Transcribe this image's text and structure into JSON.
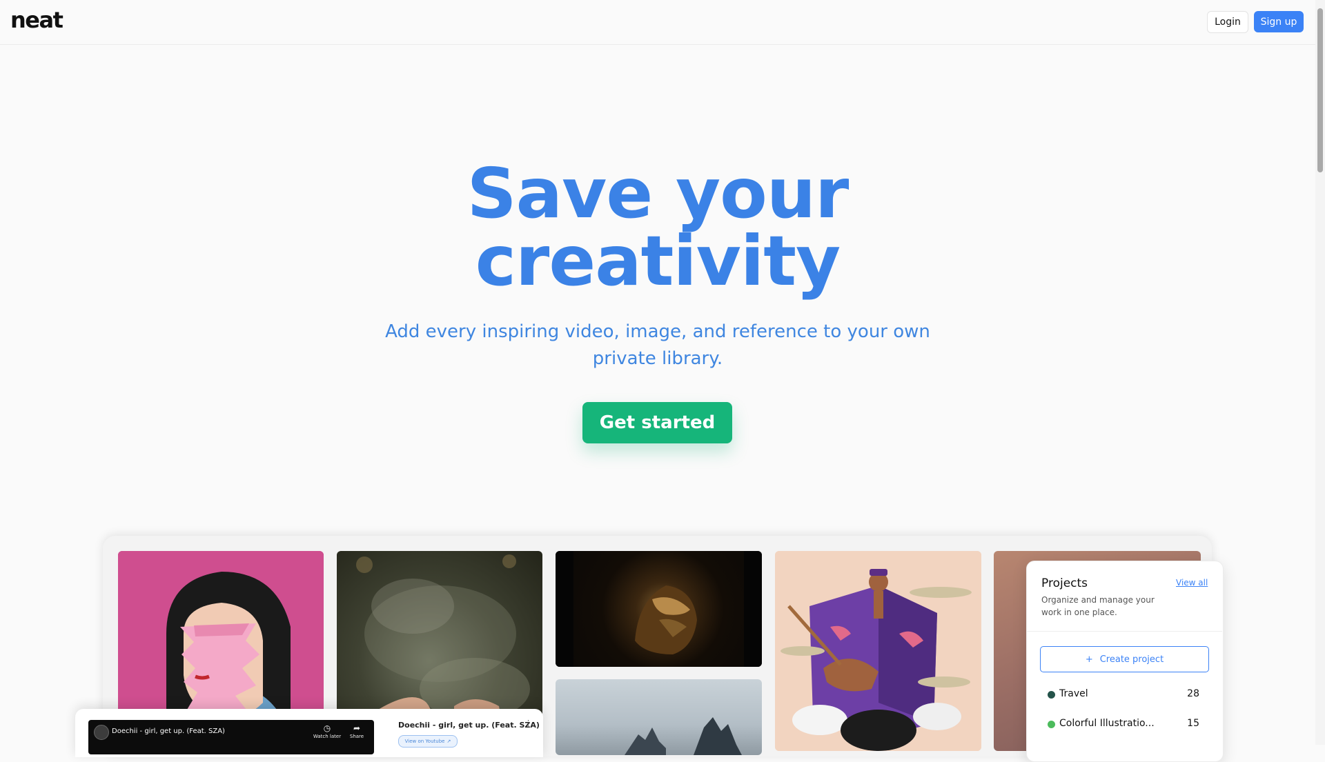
{
  "header": {
    "logo": "neat",
    "login_label": "Login",
    "signup_label": "Sign up"
  },
  "hero": {
    "title_line1": "Save your",
    "title_line2": "creativity",
    "subtitle": "Add every inspiring video, image, and reference to your own private library.",
    "cta_label": "Get started"
  },
  "video_card": {
    "player_title": "Doechii - girl, get up. (Feat. SZA)",
    "watch_later_label": "Watch later",
    "share_label": "Share",
    "side_title": "Doechii - girl, get up. (Feat. SZA)",
    "youtube_label": "View on Youtube",
    "more_icon": "⋮"
  },
  "projects": {
    "title": "Projects",
    "view_all": "View all",
    "description": "Organize and manage your work in one place.",
    "create_label": "Create project",
    "items": [
      {
        "name": "Travel",
        "count": "28",
        "color": "#24534a"
      },
      {
        "name": "Colorful Illustratio...",
        "count": "15",
        "color": "#4cbb5c"
      }
    ]
  },
  "colors": {
    "accent": "#3b82f6",
    "cta": "#16b57a",
    "hero_text": "#3b82e6"
  }
}
